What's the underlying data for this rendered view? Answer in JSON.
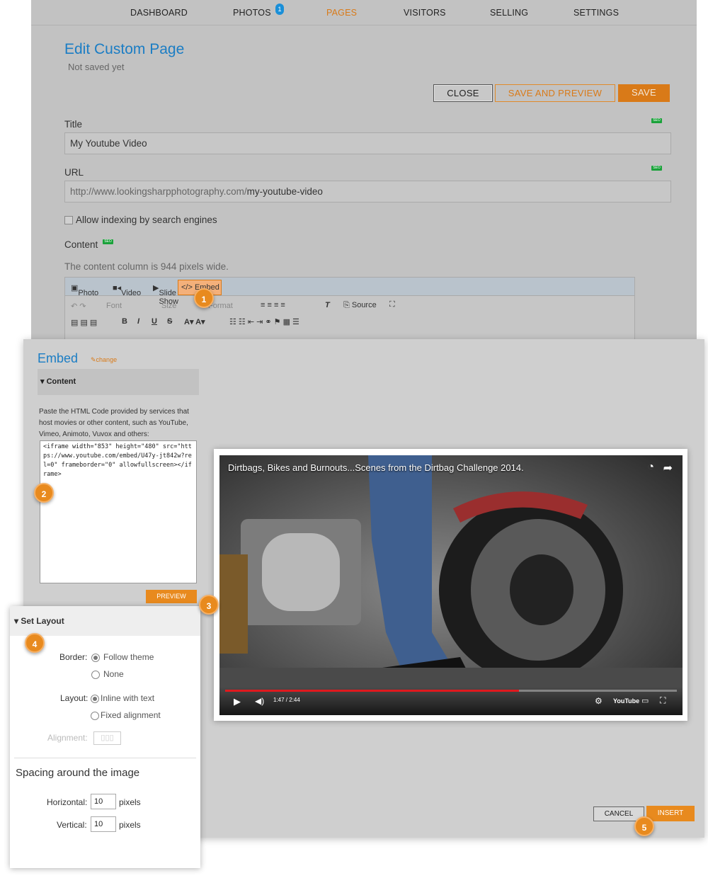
{
  "nav": {
    "dashboard": "DASHBOARD",
    "photos": "PHOTOS",
    "photos_badge": "1",
    "pages": "PAGES",
    "visitors": "VISITORS",
    "selling": "SELLING",
    "settings": "SETTINGS"
  },
  "page": {
    "title": "Edit Custom Page",
    "status": "Not saved yet"
  },
  "actions": {
    "close": "CLOSE",
    "save_preview": "SAVE AND PREVIEW",
    "save": "SAVE"
  },
  "form": {
    "title_label": "Title",
    "title_value": "My Youtube Video",
    "seo": "SEO",
    "url_label": "URL",
    "url_prefix": "http://www.lookingsharpphotography.com/",
    "url_slug": "my-youtube-video",
    "indexing_label": "Allow indexing by search engines",
    "content_label": "Content",
    "content_note": "The content column is 944 pixels wide."
  },
  "editor": {
    "tabs": {
      "photo": "Photo",
      "video": "Video",
      "slideshow": "Slide Show",
      "embed": "Embed"
    },
    "font": "Font",
    "size": "Size",
    "format": "Format",
    "source": "Source"
  },
  "steps": [
    "1",
    "2",
    "3",
    "4",
    "5"
  ],
  "embed_dialog": {
    "title": "Embed",
    "change": "change",
    "section": "Content",
    "instructions": "Paste the HTML Code provided by services that host movies or other content, such as YouTube, Vimeo, Animoto, Vuvox and others:",
    "code": "<iframe width=\"853\" height=\"480\" src=\"https://www.youtube.com/embed/U47y-jt842w?rel=0\" frameborder=\"0\" allowfullscreen></iframe>",
    "preview": "PREVIEW",
    "cancel": "CANCEL",
    "insert": "INSERT"
  },
  "video": {
    "title": "Dirtbags, Bikes and Burnouts...Scenes from the Dirtbag Challenge 2014.",
    "time": "1:47 / 2:44",
    "progress": 0.65,
    "brand": "YouTube"
  },
  "layout_panel": {
    "heading": "Set Layout",
    "border_label": "Border:",
    "border_opt1": "Follow theme",
    "border_opt2": "None",
    "layout_label": "Layout:",
    "layout_opt1": "Inline with text",
    "layout_opt2": "Fixed alignment",
    "alignment_label": "Alignment:",
    "spacing_heading": "Spacing around the image",
    "horizontal_label": "Horizontal:",
    "horizontal_value": "10",
    "vertical_label": "Vertical:",
    "vertical_value": "10",
    "unit": "pixels"
  },
  "colors": {
    "accent": "#d97a18",
    "link": "#1b7dc4",
    "seo": "#1aa23a"
  }
}
